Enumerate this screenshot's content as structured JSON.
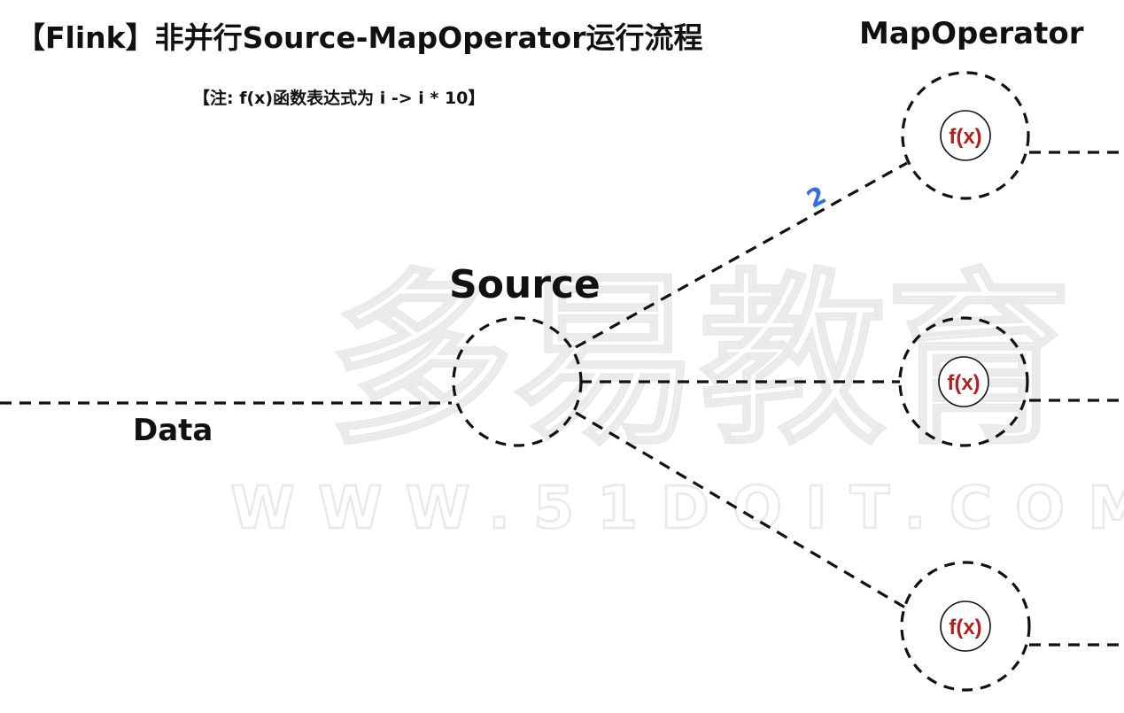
{
  "title": "【Flink】非并行Source-MapOperator运行流程",
  "note": "【注: f(x)函数表达式为 i -> i * 10】",
  "labels": {
    "map_operator": "MapOperator",
    "source": "Source",
    "data": "Data"
  },
  "annotation": "2",
  "operators": [
    {
      "function": "f(x)"
    },
    {
      "function": "f(x)"
    },
    {
      "function": "f(x)"
    }
  ],
  "watermark": {
    "brand": "多易教育",
    "site": "WWW.51DOIT.COM"
  },
  "colors": {
    "line": "#111111",
    "function_text": "#b32020",
    "annotation": "#2f6fe0",
    "watermark": "#eeeeee"
  }
}
